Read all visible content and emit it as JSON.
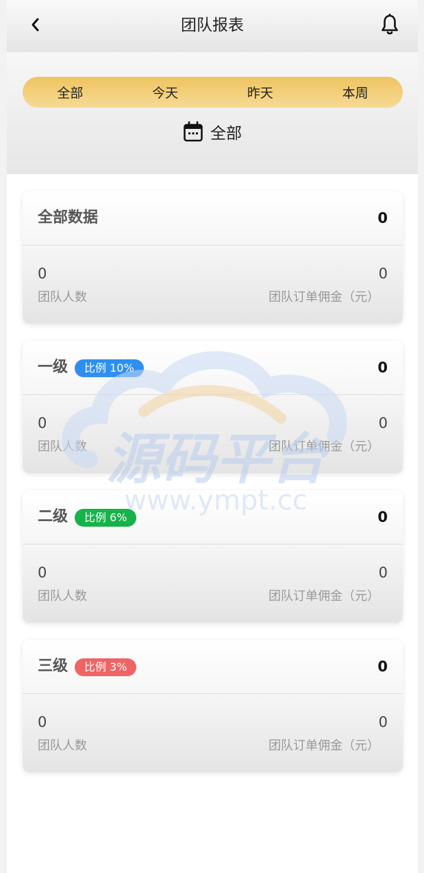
{
  "header": {
    "title": "团队报表"
  },
  "filters": {
    "tabs": [
      {
        "label": "全部"
      },
      {
        "label": "今天"
      },
      {
        "label": "昨天"
      },
      {
        "label": "本周"
      }
    ],
    "selected_date_label": "全部"
  },
  "cards": [
    {
      "title": "全部数据",
      "badge": null,
      "total": "0",
      "team_count": "0",
      "team_count_label": "团队人数",
      "commission": "0",
      "commission_label": "团队订单佣金（元）"
    },
    {
      "title": "一级",
      "badge": {
        "text": "比例 10%",
        "color": "#2e8ff0"
      },
      "total": "0",
      "team_count": "0",
      "team_count_label": "团队人数",
      "commission": "0",
      "commission_label": "团队订单佣金（元）"
    },
    {
      "title": "二级",
      "badge": {
        "text": "比例 6%",
        "color": "#16b24a"
      },
      "total": "0",
      "team_count": "0",
      "team_count_label": "团队人数",
      "commission": "0",
      "commission_label": "团队订单佣金（元）"
    },
    {
      "title": "三级",
      "badge": {
        "text": "比例 3%",
        "color": "#ef6464"
      },
      "total": "0",
      "team_count": "0",
      "team_count_label": "团队人数",
      "commission": "0",
      "commission_label": "团队订单佣金（元）"
    }
  ],
  "watermark": {
    "brand": "源码平台",
    "url": "www.ympt.cc"
  },
  "colors": {
    "tab_gradient_start": "#efc461",
    "tab_gradient_end": "#f6da94"
  }
}
